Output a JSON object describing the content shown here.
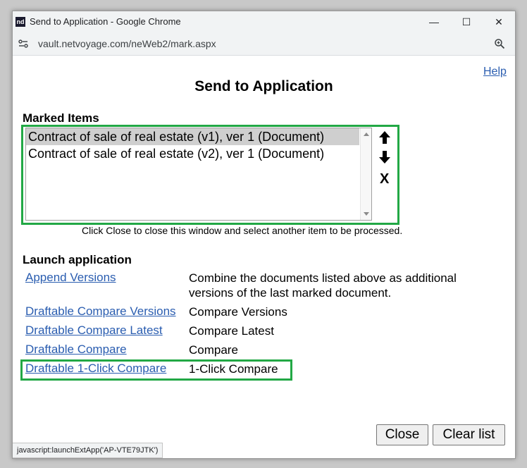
{
  "window": {
    "title": "Send to Application - Google Chrome",
    "logo_text": "nd",
    "controls": {
      "minimize": "—",
      "maximize": "☐",
      "close": "✕"
    }
  },
  "browser": {
    "url": "vault.netvoyage.com/neWeb2/mark.aspx",
    "site_info_icon": "site-settings-icon",
    "zoom_icon": "zoom-icon"
  },
  "page": {
    "help_label": "Help",
    "title": "Send to Application",
    "marked_items_label": "Marked Items",
    "marked_items": [
      {
        "label": "Contract of sale of real estate (v1), ver 1 (Document)",
        "selected": true
      },
      {
        "label": "Contract of sale of real estate (v2), ver 1 (Document)",
        "selected": false
      }
    ],
    "item_controls": {
      "up_icon": "arrow-up-icon",
      "down_icon": "arrow-down-icon",
      "remove_label": "X"
    },
    "hint": "Click Close to close this window and select another item to be processed.",
    "launch_label": "Launch application",
    "applications": [
      {
        "link": "Append Versions",
        "description": "Combine the documents listed above as additional versions of the last marked document."
      },
      {
        "link": "Draftable Compare Versions",
        "description": "Compare Versions"
      },
      {
        "link": "Draftable Compare Latest",
        "description": "Compare Latest"
      },
      {
        "link": "Draftable Compare",
        "description": "Compare"
      },
      {
        "link": "Draftable 1-Click Compare",
        "description": "1-Click Compare"
      }
    ],
    "close_button": "Close",
    "clear_button": "Clear list"
  },
  "status_bar": "javascript:launchExtApp('AP-VTE79JTK')",
  "colors": {
    "link": "#2a5db0",
    "highlight_frame": "#22a845",
    "selected_row": "#cfcfcf"
  }
}
